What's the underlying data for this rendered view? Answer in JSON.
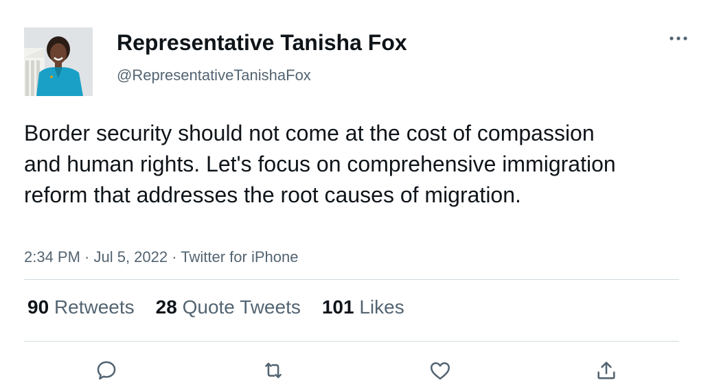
{
  "author": {
    "name": "Representative Tanisha Fox",
    "handle": "@RepresentativeTanishaFox"
  },
  "tweet": {
    "text": "Border security should not come at the cost of compassion and human rights. Let's focus on comprehensive immigration reform that addresses the root causes of migration.",
    "meta": "2:34 PM · Jul 5, 2022 · Twitter for iPhone"
  },
  "stats": {
    "retweets_count": "90",
    "retweets_label": "Retweets",
    "quotes_count": "28",
    "quotes_label": "Quote Tweets",
    "likes_count": "101",
    "likes_label": "Likes"
  },
  "icons": {
    "more": "more-horizontal-icon",
    "reply": "reply-icon",
    "retweet": "retweet-icon",
    "like": "heart-icon",
    "share": "share-icon"
  },
  "colors": {
    "text_primary": "#0f1419",
    "text_secondary": "#536471",
    "divider": "#cfd9de"
  }
}
